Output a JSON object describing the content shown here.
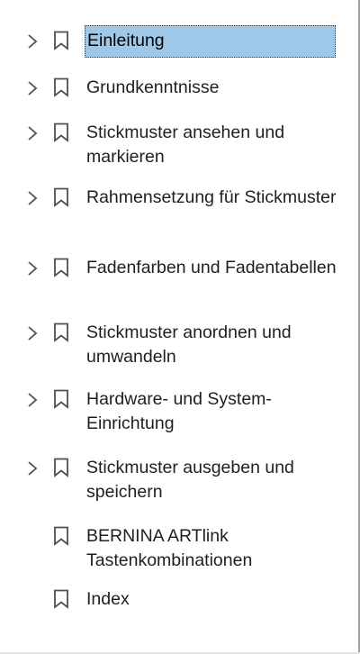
{
  "bookmarks_panel": {
    "items": [
      {
        "label": "Einleitung",
        "has_children": true,
        "selected": true
      },
      {
        "label": "Grundkenntnisse",
        "has_children": true,
        "selected": false
      },
      {
        "label": "Stickmuster ansehen und markieren",
        "has_children": true,
        "selected": false
      },
      {
        "label": "Rahmensetzung für Stickmuster",
        "has_children": true,
        "selected": false
      },
      {
        "label": "Fadenfarben und Fadentabellen",
        "has_children": true,
        "selected": false
      },
      {
        "label": "Stickmuster anordnen und umwandeln",
        "has_children": true,
        "selected": false
      },
      {
        "label": "Hardware- und System-Einrichtung",
        "has_children": true,
        "selected": false
      },
      {
        "label": "Stickmuster ausgeben und speichern",
        "has_children": true,
        "selected": false
      },
      {
        "label": "BERNINA ARTlink Tastenkombinationen",
        "has_children": false,
        "selected": false
      },
      {
        "label": "Index",
        "has_children": false,
        "selected": false
      }
    ],
    "colors": {
      "selection_background": "#9fc8e8",
      "text": "#1f1f1f",
      "icon": "#505050",
      "border": "#a0a0a0"
    },
    "icons": {
      "expand": "chevron-right-icon",
      "bookmark": "bookmark-icon"
    }
  }
}
